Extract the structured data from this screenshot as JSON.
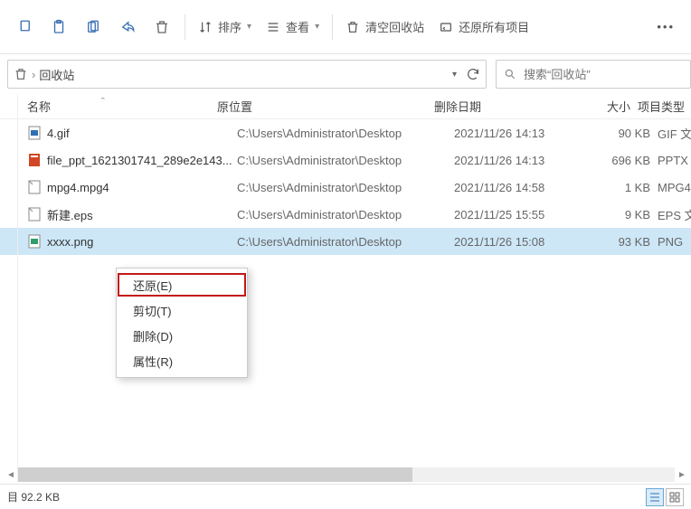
{
  "toolbar": {
    "sort_label": "排序",
    "view_label": "查看",
    "empty_label": "清空回收站",
    "restore_all_label": "还原所有项目"
  },
  "address": {
    "location": "回收站",
    "search_placeholder": "搜索“回收站”"
  },
  "columns": {
    "name": "名称",
    "location": "原位置",
    "date": "删除日期",
    "size": "大小",
    "type": "项目类型"
  },
  "files": [
    {
      "name": "4.gif",
      "loc": "C:\\Users\\Administrator\\Desktop",
      "date": "2021/11/26 14:13",
      "size": "90 KB",
      "type": "GIF 文件"
    },
    {
      "name": "file_ppt_1621301741_289e2e143...",
      "loc": "C:\\Users\\Administrator\\Desktop",
      "date": "2021/11/26 14:13",
      "size": "696 KB",
      "type": "PPTX"
    },
    {
      "name": "mpg4.mpg4",
      "loc": "C:\\Users\\Administrator\\Desktop",
      "date": "2021/11/26 14:58",
      "size": "1 KB",
      "type": "MPG4"
    },
    {
      "name": "新建.eps",
      "loc": "C:\\Users\\Administrator\\Desktop",
      "date": "2021/11/25 15:55",
      "size": "9 KB",
      "type": "EPS 文件"
    },
    {
      "name": "xxxx.png",
      "loc": "C:\\Users\\Administrator\\Desktop",
      "date": "2021/11/26 15:08",
      "size": "93 KB",
      "type": "PNG"
    }
  ],
  "context_menu": {
    "restore": "还原(E)",
    "cut": "剪切(T)",
    "delete": "删除(D)",
    "properties": "属性(R)"
  },
  "status": {
    "text": "目 92.2 KB"
  },
  "icon_colors": {
    "gif": "#2f6fb3",
    "ppt": "#d24726",
    "generic": "#7a7a7a",
    "png": "#2f9e6a"
  }
}
